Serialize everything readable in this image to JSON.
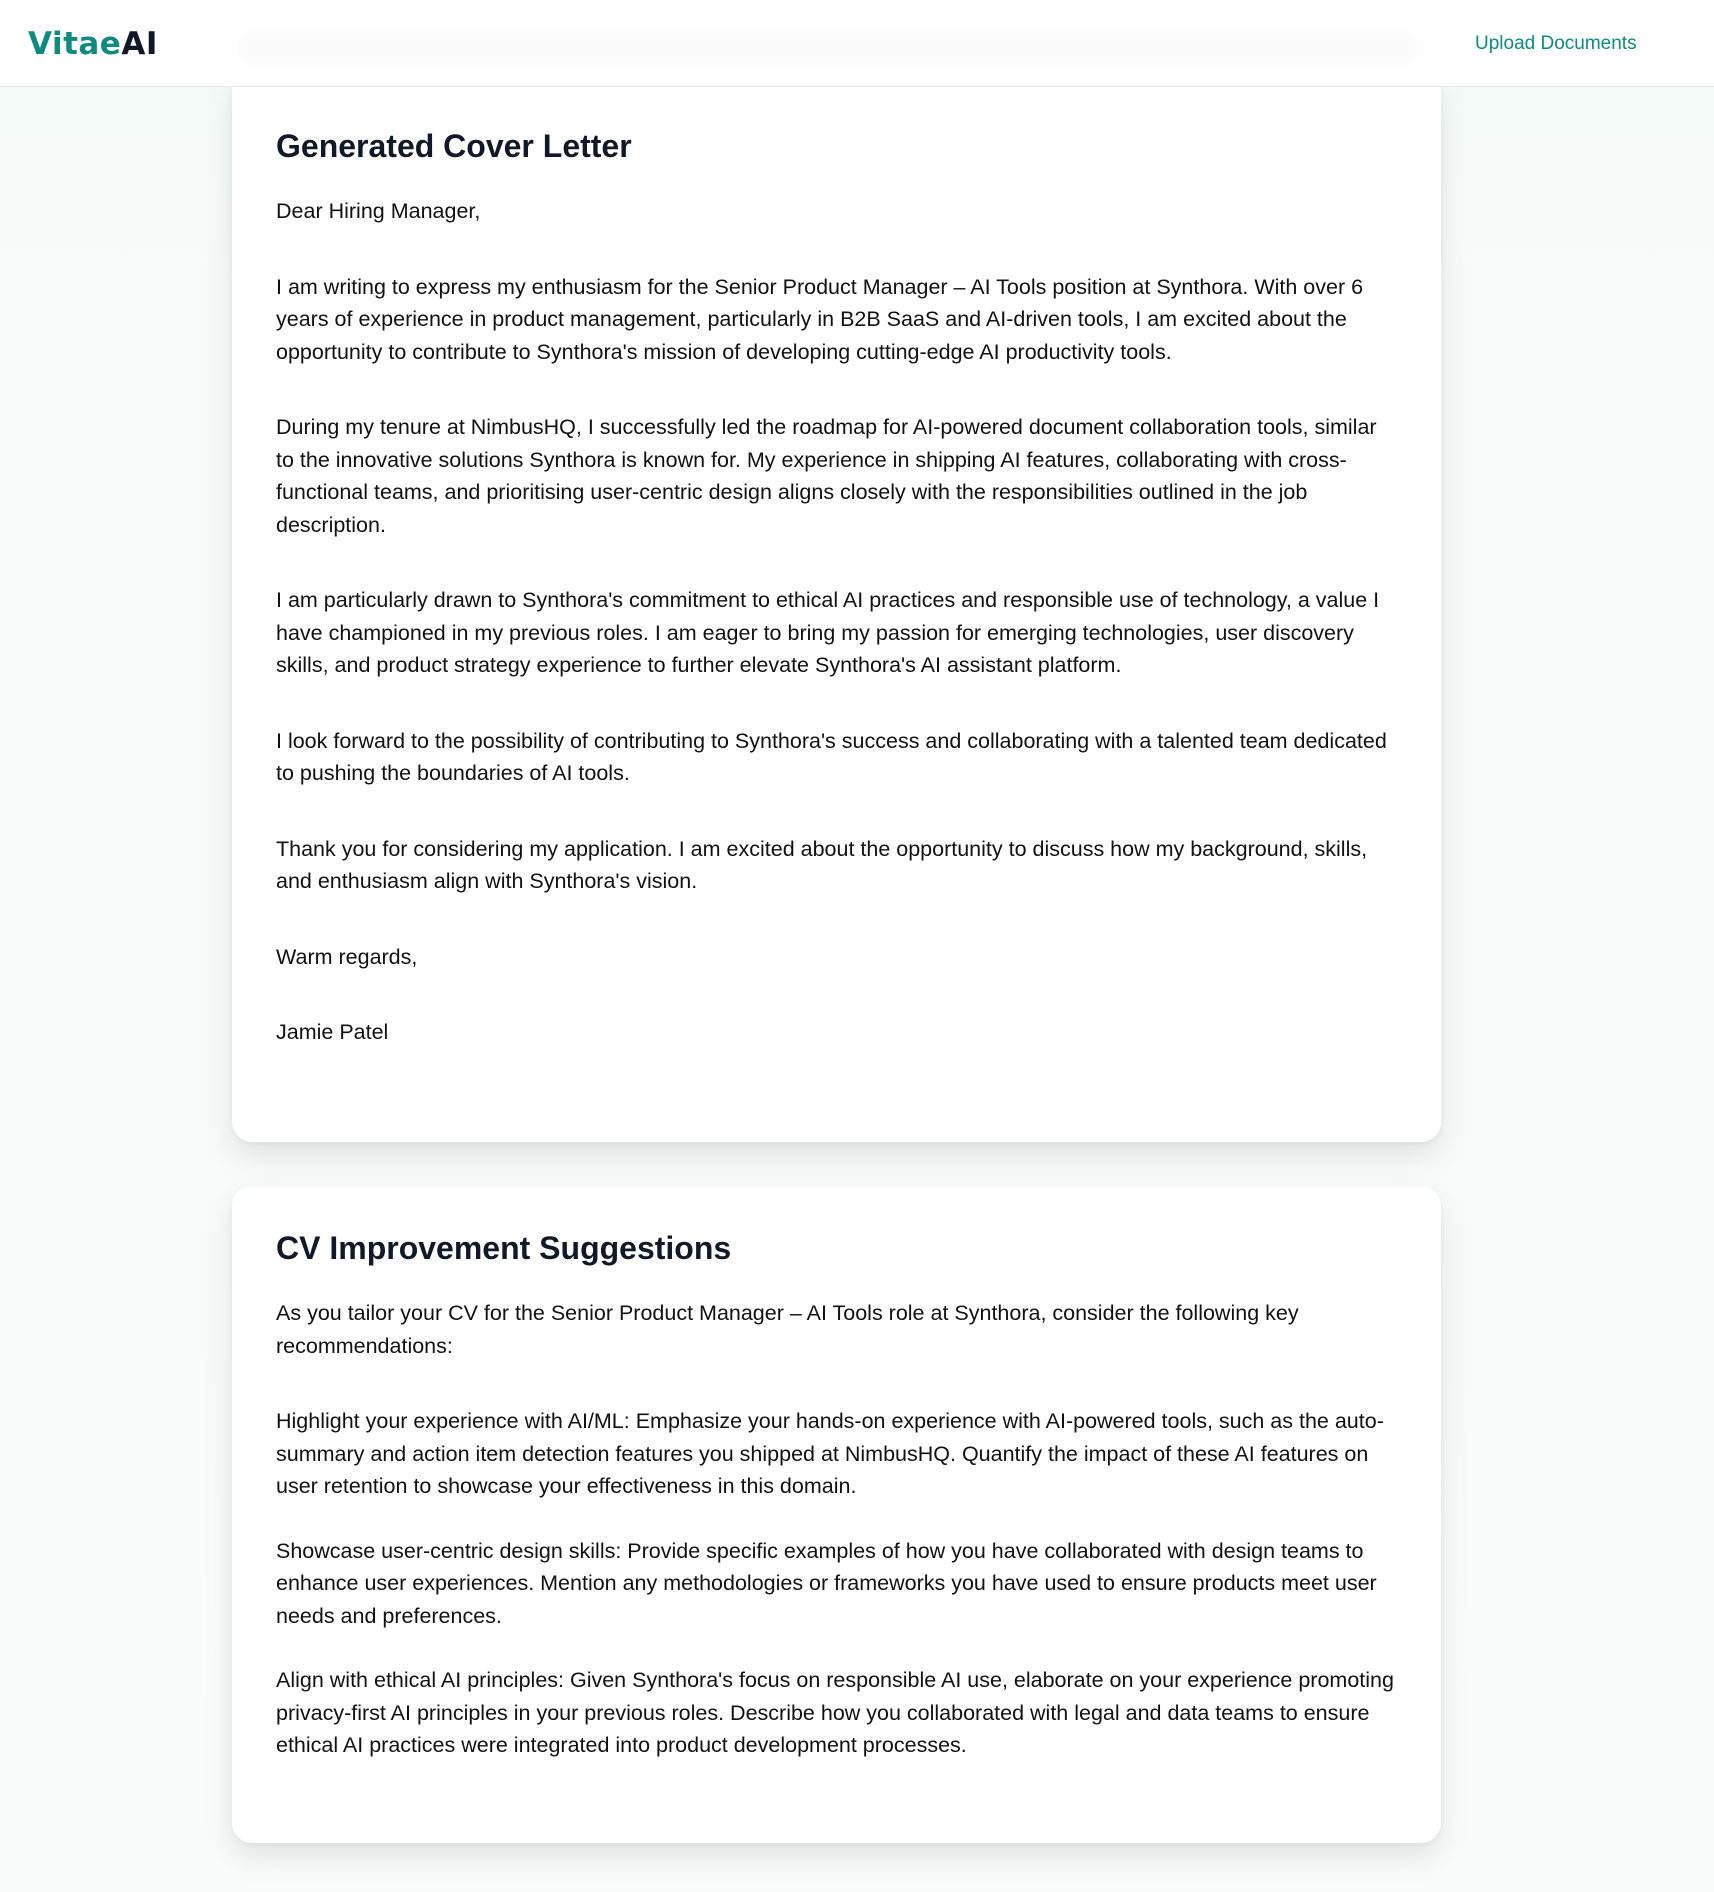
{
  "header": {
    "brand_part1": "Vitae",
    "brand_part2": "AI",
    "upload_label": "Upload Documents"
  },
  "cover_letter": {
    "title": "Generated Cover Letter",
    "greeting": "Dear Hiring Manager,",
    "paragraphs": [
      "I am writing to express my enthusiasm for the Senior Product Manager – AI Tools position at Synthora. With over 6 years of experience in product management, particularly in B2B SaaS and AI-driven tools, I am excited about the opportunity to contribute to Synthora's mission of developing cutting-edge AI productivity tools.",
      "During my tenure at NimbusHQ, I successfully led the roadmap for AI-powered document collaboration tools, similar to the innovative solutions Synthora is known for. My experience in shipping AI features, collaborating with cross-functional teams, and prioritising user-centric design aligns closely with the responsibilities outlined in the job description.",
      "I am particularly drawn to Synthora's commitment to ethical AI practices and responsible use of technology, a value I have championed in my previous roles. I am eager to bring my passion for emerging technologies, user discovery skills, and product strategy experience to further elevate Synthora's AI assistant platform.",
      "I look forward to the possibility of contributing to Synthora's success and collaborating with a talented team dedicated to pushing the boundaries of AI tools.",
      "Thank you for considering my application. I am excited about the opportunity to discuss how my background, skills, and enthusiasm align with Synthora's vision."
    ],
    "closing": "Warm regards,",
    "signature": "Jamie Patel"
  },
  "cv_suggestions": {
    "title": "CV Improvement Suggestions",
    "intro": "As you tailor your CV for the Senior Product Manager – AI Tools role at Synthora, consider the following key recommendations:",
    "items": [
      "Highlight your experience with AI/ML: Emphasize your hands-on experience with AI-powered tools, such as the auto-summary and action item detection features you shipped at NimbusHQ. Quantify the impact of these AI features on user retention to showcase your effectiveness in this domain.",
      "Showcase user-centric design skills: Provide specific examples of how you have collaborated with design teams to enhance user experiences. Mention any methodologies or frameworks you have used to ensure products meet user needs and preferences.",
      "Align with ethical AI principles: Given Synthora's focus on responsible AI use, elaborate on your experience promoting privacy-first AI principles in your previous roles. Describe how you collaborated with legal and data teams to ensure ethical AI practices were integrated into product development processes."
    ]
  }
}
